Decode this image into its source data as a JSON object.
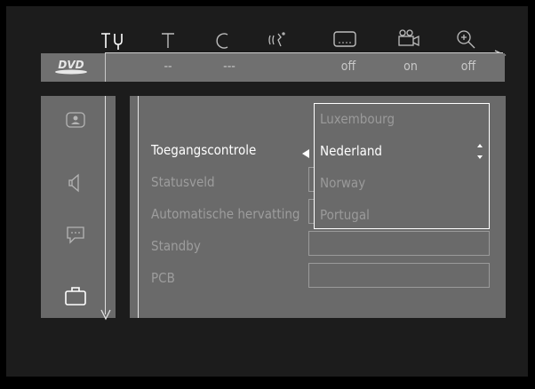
{
  "top_icons": [
    {
      "name": "setup-tools-icon",
      "active": true
    },
    {
      "name": "title-icon",
      "active": false
    },
    {
      "name": "chapter-icon",
      "active": false
    },
    {
      "name": "audio-icon",
      "active": false
    },
    {
      "name": "subtitle-icon",
      "active": false
    },
    {
      "name": "camera-angle-icon",
      "active": false
    },
    {
      "name": "zoom-icon",
      "active": false
    }
  ],
  "status_band": {
    "disc_logo": "DVD",
    "values": [
      "--",
      "---",
      "",
      "off",
      "on",
      "off"
    ]
  },
  "sidebar": {
    "items": [
      {
        "name": "picture-icon",
        "active": false
      },
      {
        "name": "sound-icon",
        "active": false
      },
      {
        "name": "language-icon",
        "active": false
      },
      {
        "name": "features-icon",
        "active": true
      }
    ]
  },
  "menu": {
    "items": [
      {
        "label": "Toegangscontrole",
        "active": true
      },
      {
        "label": "Statusveld",
        "active": false
      },
      {
        "label": "Automatische hervatting",
        "active": false
      },
      {
        "label": "Standby",
        "active": false
      },
      {
        "label": "PCB",
        "active": false
      }
    ]
  },
  "dropdown": {
    "options": [
      "Luxembourg",
      "Nederland",
      "Norway",
      "Portugal"
    ],
    "selected": "Nederland"
  },
  "colors": {
    "band": "#707070",
    "panel": "#6a6a6a",
    "active_text": "#ffffff",
    "inactive_text": "#9d9d9d"
  }
}
